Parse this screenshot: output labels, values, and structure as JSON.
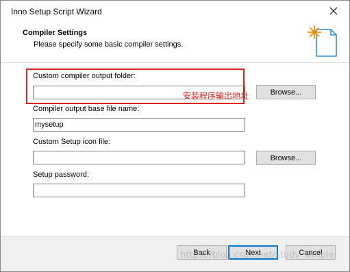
{
  "window": {
    "title": "Inno Setup Script Wizard"
  },
  "header": {
    "title": "Compiler Settings",
    "subtitle": "Please specify some basic compiler settings."
  },
  "fields": {
    "output_folder": {
      "label": "Custom compiler output folder:",
      "value": ""
    },
    "base_file_name": {
      "label": "Compiler output base file name:",
      "value": "mysetup"
    },
    "icon_file": {
      "label": "Custom Setup icon file:",
      "value": ""
    },
    "password": {
      "label": "Setup password:",
      "value": ""
    }
  },
  "buttons": {
    "browse_output": "Browse...",
    "browse_icon": "Browse...",
    "back": "Back",
    "next": "Next",
    "cancel": "Cancel"
  },
  "annotation": {
    "text": "安装程序输出地址",
    "color": "#e0201c"
  },
  "watermark": "https://blog.csdn.net/study_simple",
  "colors": {
    "accent": "#0078d7",
    "annotation_red": "#e0201c",
    "footer_bg": "#f0f0f0"
  }
}
